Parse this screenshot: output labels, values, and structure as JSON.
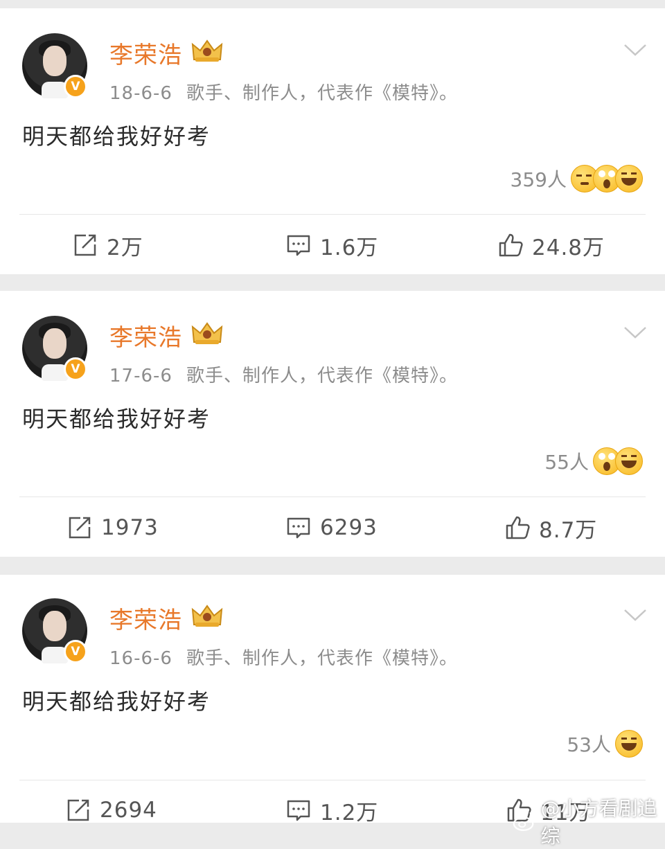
{
  "posts": [
    {
      "username": "李荣浩",
      "date": "18-6-6",
      "bio": "歌手、制作人，代表作《模特》。",
      "content": "明天都给我好好考",
      "reaction_count": "359人",
      "reaction_emojis": [
        "sleepy",
        "wow",
        "laugh"
      ],
      "repost": "2万",
      "comment": "1.6万",
      "like": "24.8万"
    },
    {
      "username": "李荣浩",
      "date": "17-6-6",
      "bio": "歌手、制作人，代表作《模特》。",
      "content": "明天都给我好好考",
      "reaction_count": "55人",
      "reaction_emojis": [
        "wow",
        "laugh"
      ],
      "repost": "1973",
      "comment": "6293",
      "like": "8.7万"
    },
    {
      "username": "李荣浩",
      "date": "16-6-6",
      "bio": "歌手、制作人，代表作《模特》。",
      "content": "明天都给我好好考",
      "reaction_count": "53人",
      "reaction_emojis": [
        "laugh"
      ],
      "repost": "2694",
      "comment": "1.2万",
      "like": "11万"
    }
  ],
  "verified_badge": "V",
  "watermark": "@小方看剧追综",
  "colors": {
    "username": "#e8782a",
    "badge": "#f6a21b",
    "meta": "#8c8c8c",
    "text": "#2b2b2b",
    "background": "#ebebeb"
  },
  "icons": {
    "repost": "repost-icon",
    "comment": "comment-icon",
    "like": "thumbs-up-icon",
    "menu": "chevron-down-icon",
    "crown": "crown-icon"
  }
}
